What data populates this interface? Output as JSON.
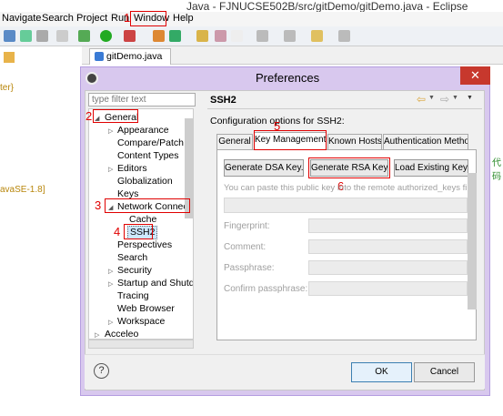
{
  "window": {
    "title": "Java - FJNUCSE502B/src/gitDemo/gitDemo.java - Eclipse"
  },
  "menubar": {
    "items": [
      "Navigate",
      "Search",
      "Project",
      "Run",
      "Window",
      "Help"
    ]
  },
  "editor": {
    "tab_label": "gitDemo.java",
    "side_text_1": "ter}",
    "side_text_2": "avaSE-1.8]",
    "side_text_3": "代码"
  },
  "annotations": [
    "1",
    "2",
    "3",
    "4",
    "5",
    "6"
  ],
  "dialog": {
    "title": "Preferences",
    "filter_placeholder": "type filter text",
    "tree": [
      {
        "label": "General",
        "expanded": true
      },
      {
        "label": "Appearance",
        "expanded": false
      },
      {
        "label": "Compare/Patch"
      },
      {
        "label": "Content Types"
      },
      {
        "label": "Editors",
        "expanded": false
      },
      {
        "label": "Globalization"
      },
      {
        "label": "Keys"
      },
      {
        "label": "Network Connectio",
        "expanded": true
      },
      {
        "label": "Cache"
      },
      {
        "label": "SSH2",
        "selected": true
      },
      {
        "label": "Perspectives"
      },
      {
        "label": "Search"
      },
      {
        "label": "Security",
        "expanded": false
      },
      {
        "label": "Startup and Shutd",
        "expanded": false
      },
      {
        "label": "Tracing"
      },
      {
        "label": "Web Browser"
      },
      {
        "label": "Workspace",
        "expanded": false
      },
      {
        "label": "Acceleo",
        "expanded": false
      }
    ],
    "page_title": "SSH2",
    "config_label": "Configuration options for SSH2:",
    "tabs": [
      "General",
      "Key Management",
      "Known Hosts",
      "Authentication Metho"
    ],
    "active_tab": "Key Management",
    "buttons": {
      "dsa": "Generate DSA Key...",
      "rsa": "Generate RSA Key...",
      "load": "Load Existing Key..."
    },
    "paste_hint": "You can paste this public key into the remote authorized_keys file",
    "fields": {
      "fingerprint": "Fingerprint:",
      "comment": "Comment:",
      "passphrase": "Passphrase:",
      "confirm": "Confirm passphrase:"
    },
    "help_icon": "?",
    "ok_label": "OK",
    "cancel_label": "Cancel"
  },
  "colors": {
    "annotation": "#e00000",
    "dialog_frame": "#d8c8ee",
    "selection": "#cde8ff"
  }
}
